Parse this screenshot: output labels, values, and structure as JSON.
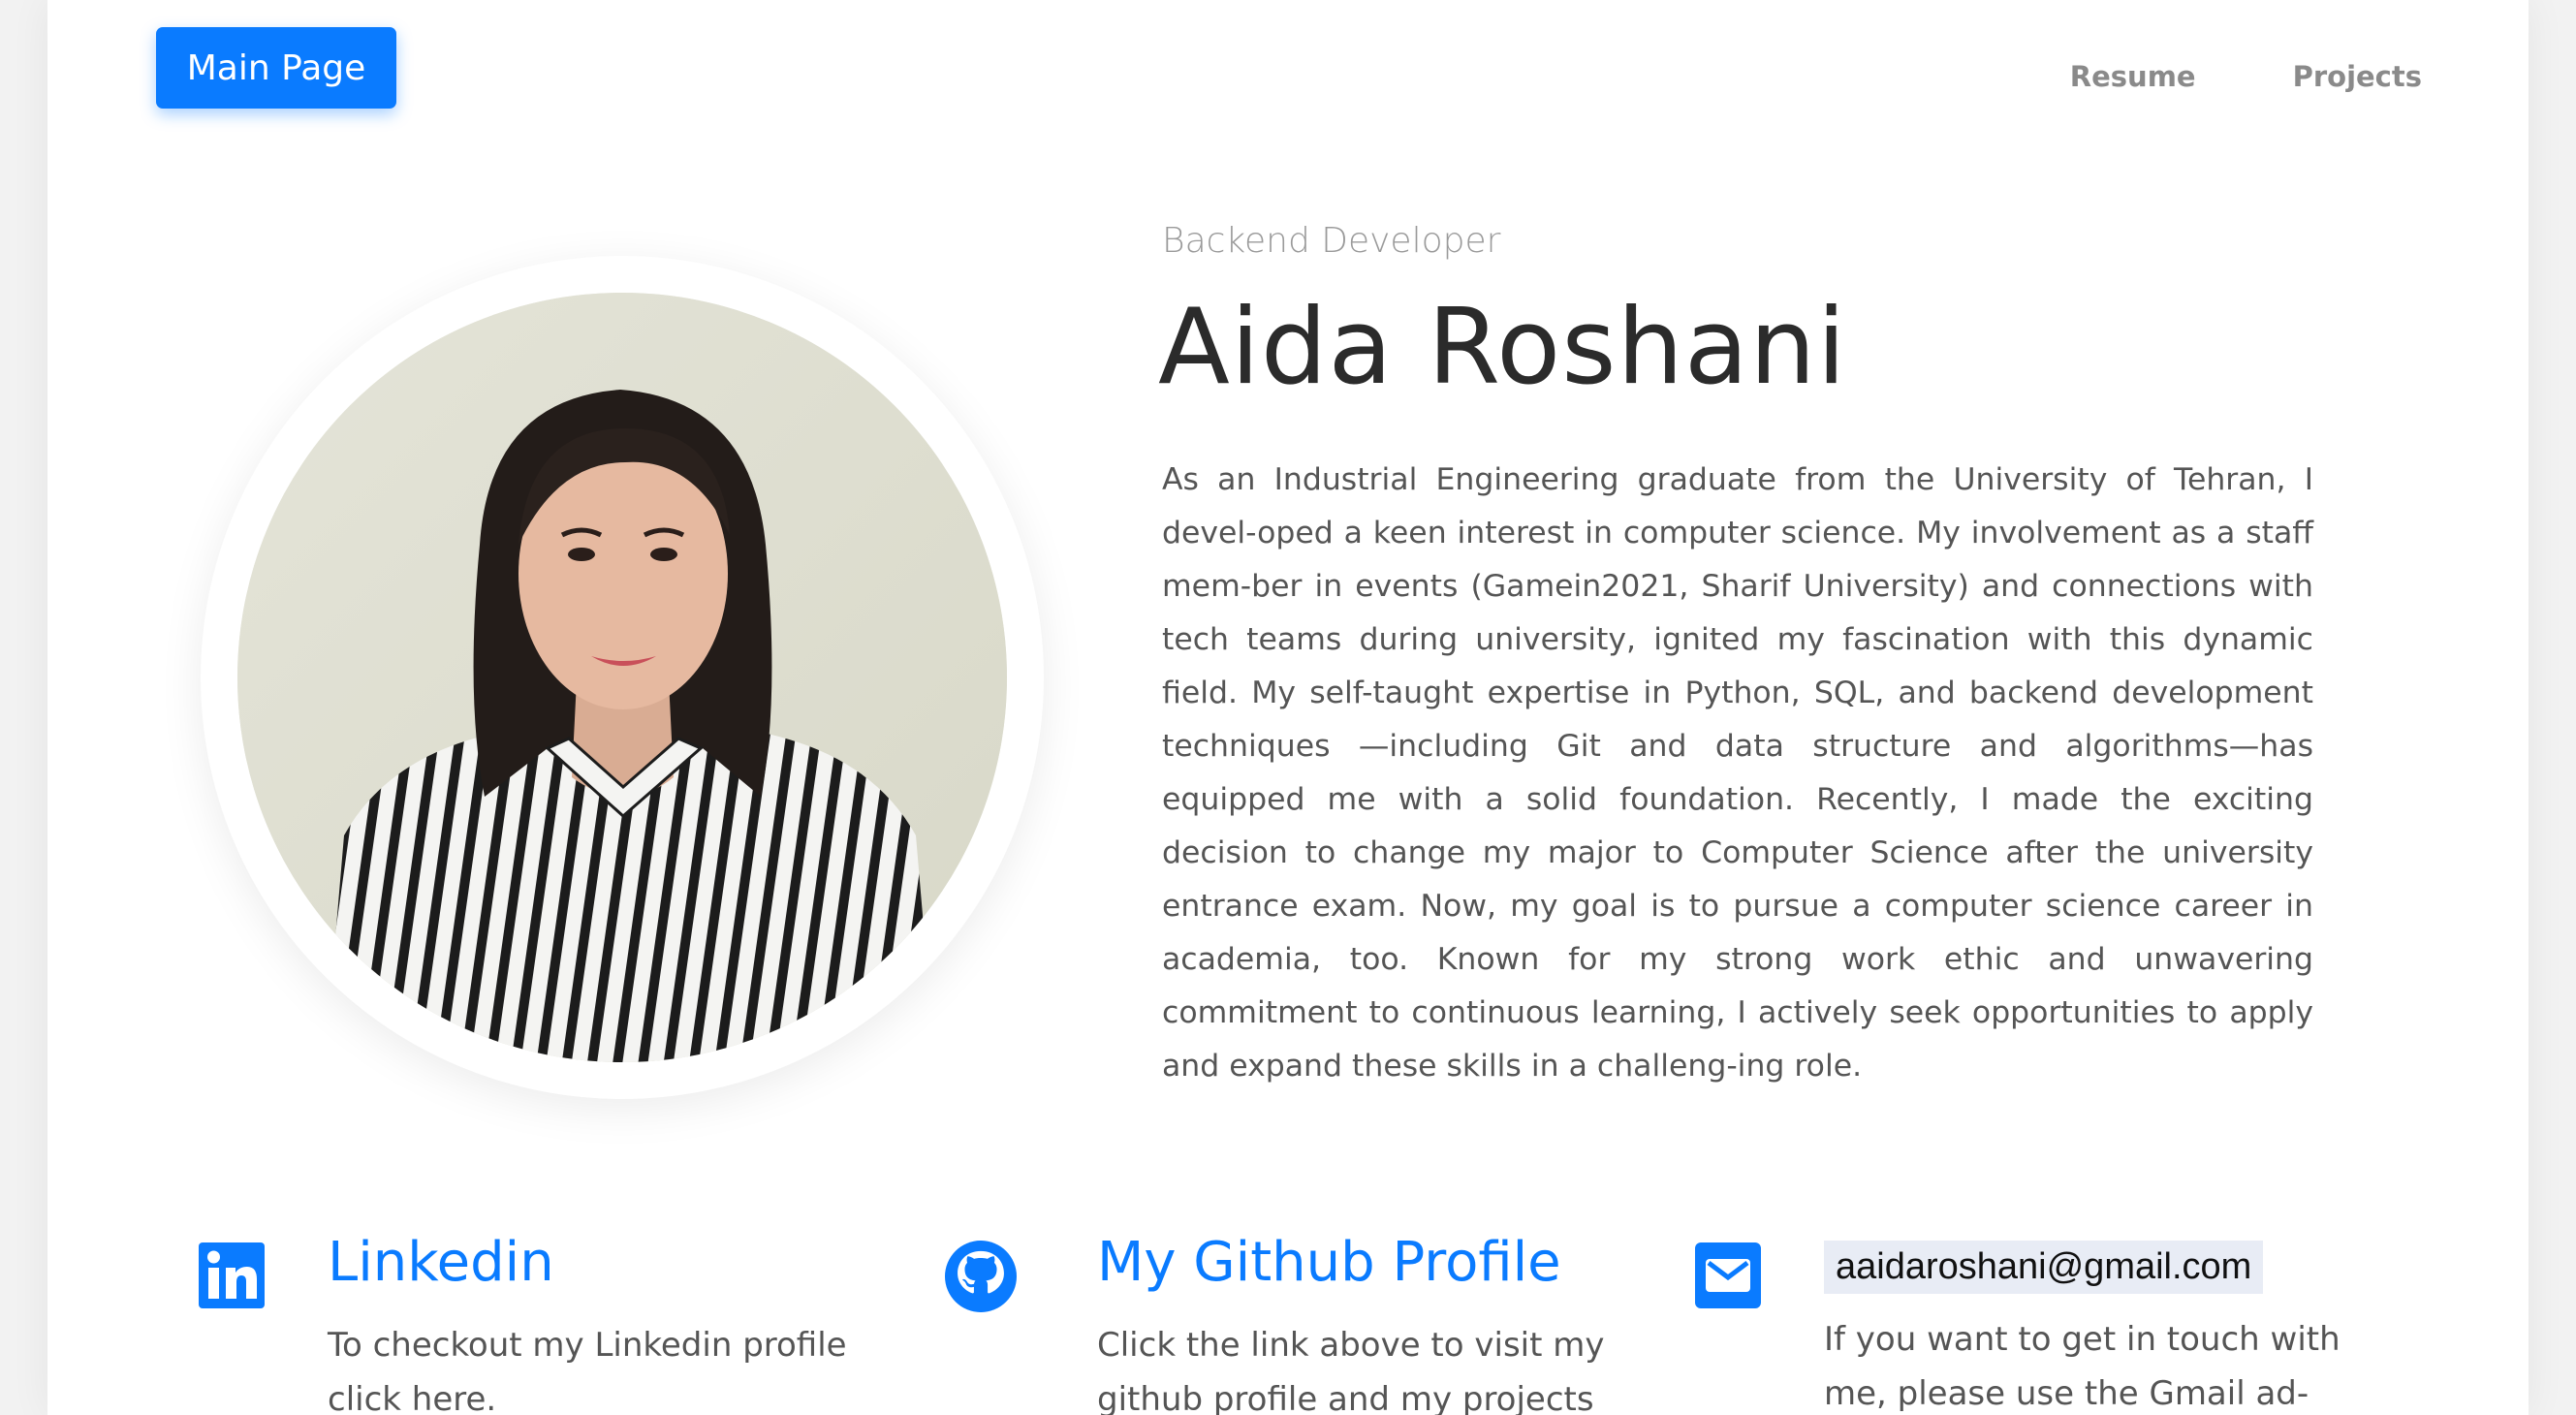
{
  "header": {
    "main_button": "Main Page",
    "nav": [
      {
        "label": "Resume"
      },
      {
        "label": "Projects"
      }
    ]
  },
  "hero": {
    "subtitle": "Backend Developer",
    "name": "Aida Roshani",
    "bio": "As an Industrial Engineering graduate from the University of Tehran, I devel-oped a keen interest in computer science. My involvement as a staff mem-ber in events (Gamein2021, Sharif University) and connections with tech teams during university, ignited my fascination with this dynamic field. My self-taught expertise in Python, SQL, and backend development techniques —including Git and data structure and algorithms—has equipped me with a solid foundation. Recently, I made the exciting decision to change my major to Computer Science after the university entrance exam. Now, my goal is to pursue a computer science career in academia, too. Known for my strong work ethic and unwavering commitment to continuous learning, I actively seek opportunities to apply and expand these skills in a challeng-ing role."
  },
  "contacts": [
    {
      "icon": "linkedin-icon",
      "title": "Linkedin",
      "desc": "To checkout my Linkedin profile click here."
    },
    {
      "icon": "github-icon",
      "title": "My Github Profile",
      "desc": "Click the link above to visit my github profile and my projects"
    },
    {
      "icon": "mail-icon",
      "title": "aaidaroshani@gmail.com",
      "desc": "If you want to get in touch with me, please use the Gmail ad-"
    }
  ],
  "colors": {
    "accent": "#0a7bff",
    "text": "#555555",
    "heading": "#2b2b2b"
  }
}
